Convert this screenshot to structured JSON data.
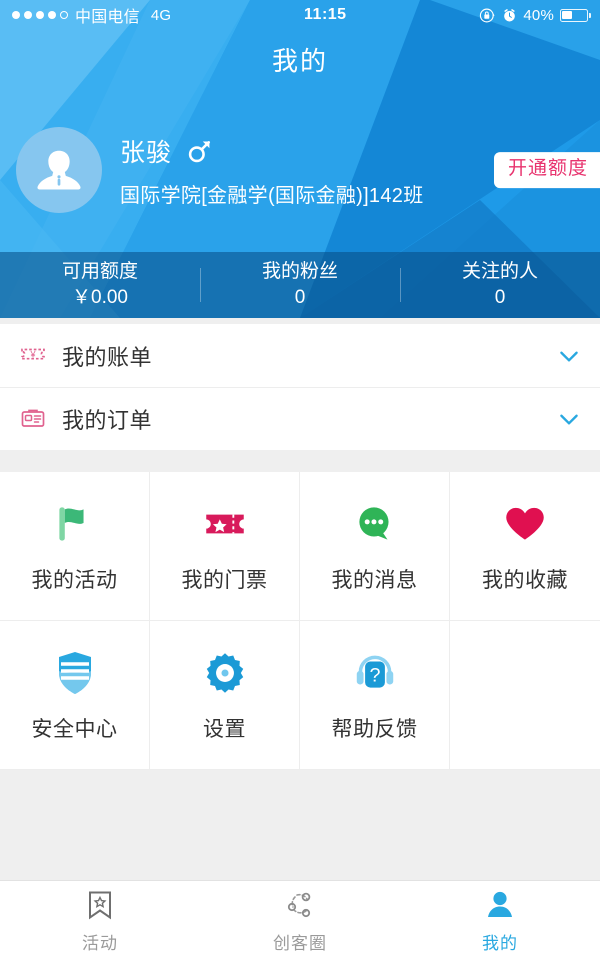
{
  "status_bar": {
    "carrier": "中国电信",
    "network": "4G",
    "time": "11:15",
    "battery_percent": "40%",
    "signal_dots_filled": 4,
    "signal_dots_total": 5,
    "rotation_lock_icon": "rotation-lock-icon",
    "alarm_icon": "alarm-clock-icon",
    "battery_icon": "battery-icon"
  },
  "header": {
    "title": "我的",
    "accent_color": "#1e9ae8",
    "credit_button_label": "开通额度",
    "credit_button_text_color": "#e8336e"
  },
  "profile": {
    "avatar_icon": "default-avatar-icon",
    "name": "张骏",
    "gender_icon": "male-gender-icon",
    "class_info": "国际学院[金融学(国际金融)]142班"
  },
  "stats": [
    {
      "label": "可用额度",
      "value": "￥0.00"
    },
    {
      "label": "我的粉丝",
      "value": "0"
    },
    {
      "label": "关注的人",
      "value": "0"
    }
  ],
  "list_rows": [
    {
      "label": "我的账单",
      "icon": "bill-ticket-icon",
      "icon_color": "#e0628f",
      "chevron": "chevron-down-icon"
    },
    {
      "label": "我的订单",
      "icon": "order-card-icon",
      "icon_color": "#e0628f",
      "chevron": "chevron-down-icon"
    }
  ],
  "grid_items": [
    {
      "label": "我的活动",
      "icon": "flag-icon",
      "color": "#3cb878"
    },
    {
      "label": "我的门票",
      "icon": "ticket-star-icon",
      "color": "#d81a5b"
    },
    {
      "label": "我的消息",
      "icon": "chat-bubble-icon",
      "color": "#2fb457"
    },
    {
      "label": "我的收藏",
      "icon": "heart-icon",
      "color": "#e01050"
    },
    {
      "label": "安全中心",
      "icon": "shield-icon",
      "color": "#29a8e0"
    },
    {
      "label": "设置",
      "icon": "gear-icon",
      "color": "#1b9ad6"
    },
    {
      "label": "帮助反馈",
      "icon": "headset-help-icon",
      "color": "#29a8e0"
    },
    {
      "label": "",
      "icon": "",
      "color": ""
    }
  ],
  "tabs": [
    {
      "label": "活动",
      "icon": "bookmark-star-icon",
      "active": false
    },
    {
      "label": "创客圈",
      "icon": "network-nodes-icon",
      "active": false
    },
    {
      "label": "我的",
      "icon": "person-icon",
      "active": true
    }
  ],
  "tab_active_color": "#29a8e0",
  "tab_inactive_color": "#9a9a9a"
}
